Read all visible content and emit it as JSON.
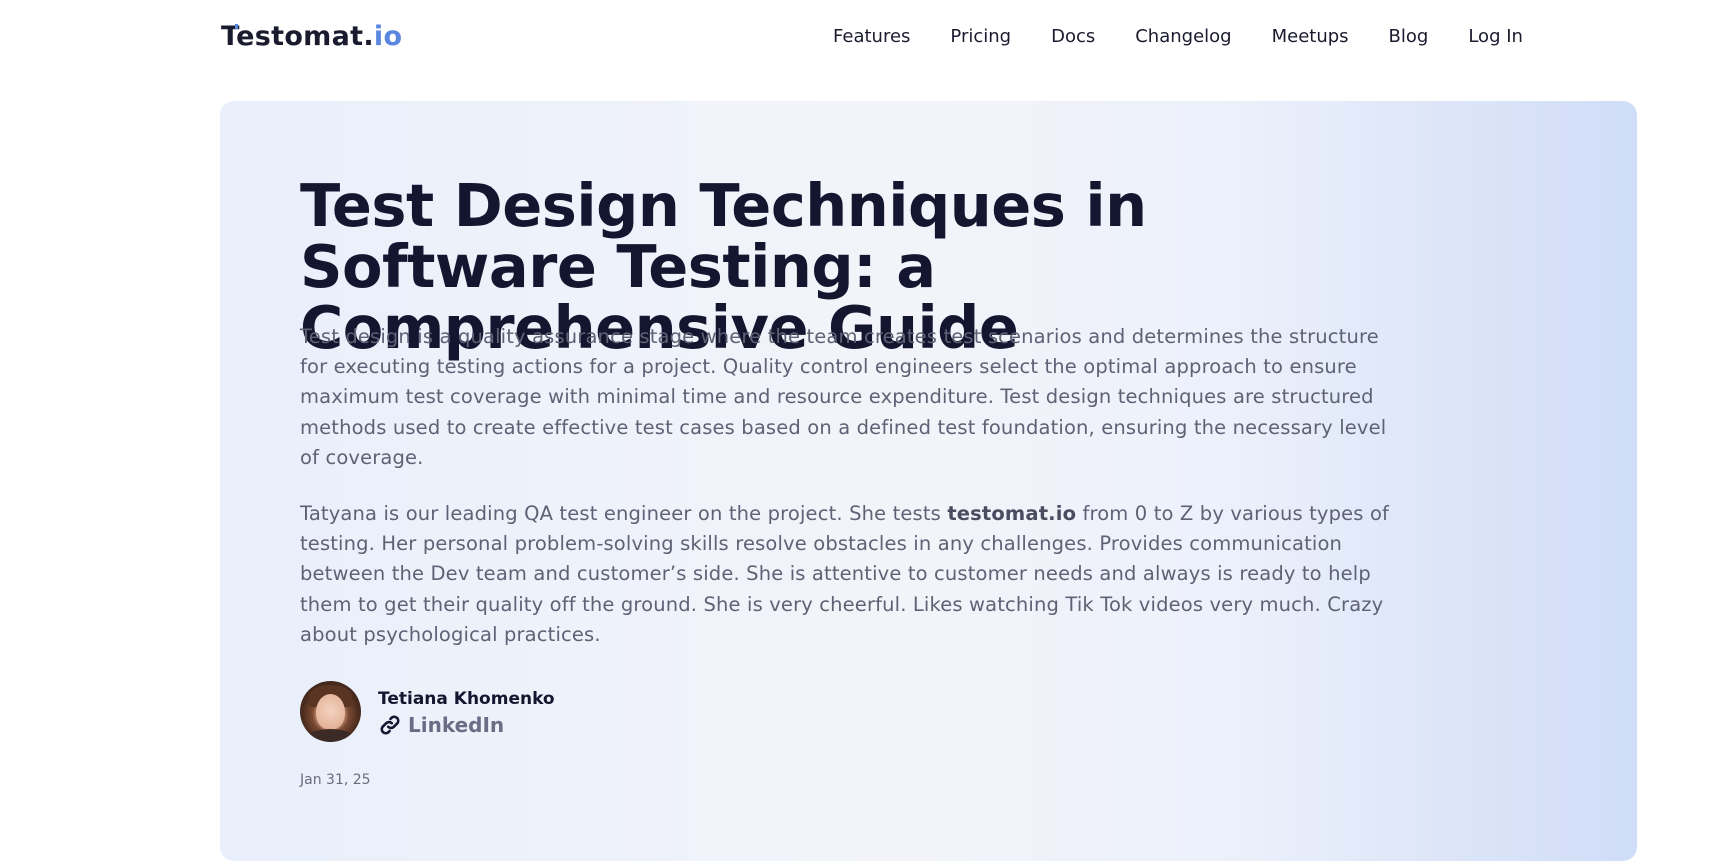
{
  "header": {
    "logo": {
      "text": "Testomat.",
      "accent": ".io"
    },
    "nav": [
      {
        "label": "Features"
      },
      {
        "label": "Pricing"
      },
      {
        "label": "Docs"
      },
      {
        "label": "Changelog"
      },
      {
        "label": "Meetups"
      },
      {
        "label": "Blog"
      },
      {
        "label": "Log In"
      }
    ]
  },
  "article": {
    "title": "Test Design Techniques in Software Testing: a Comprehensive Guide",
    "intro": "Test design  is a quality assurance stage where the team creates test scenarios and determines the structure for executing testing actions for a project. Quality control engineers select the optimal approach to ensure maximum test coverage with minimal time and resource expenditure. Test design techniques are structured methods used to create effective test cases based on a defined test foundation, ensuring the necessary level of coverage.",
    "bio": {
      "before": "Tatyana is our leading QA test engineer on the project. She tests ",
      "bold": "testomat.io",
      "after": " from 0 to Z by various types of testing. Her personal problem-solving skills resolve obstacles in any challenges. Provides communication between the Dev team and customer’s side. She is attentive to customer needs and always is ready to help them to get their quality off the ground. She is very cheerful. Likes watching Tik Tok videos very much. Crazy about psychological practices."
    },
    "author": {
      "name": "Tetiana Khomenko",
      "link_label": "LinkedIn",
      "link_icon": "link-icon"
    },
    "date": "Jan 31, 25"
  },
  "colors": {
    "accent": "#5a86e0",
    "heading": "#141630",
    "body_text": "#5f6175"
  }
}
